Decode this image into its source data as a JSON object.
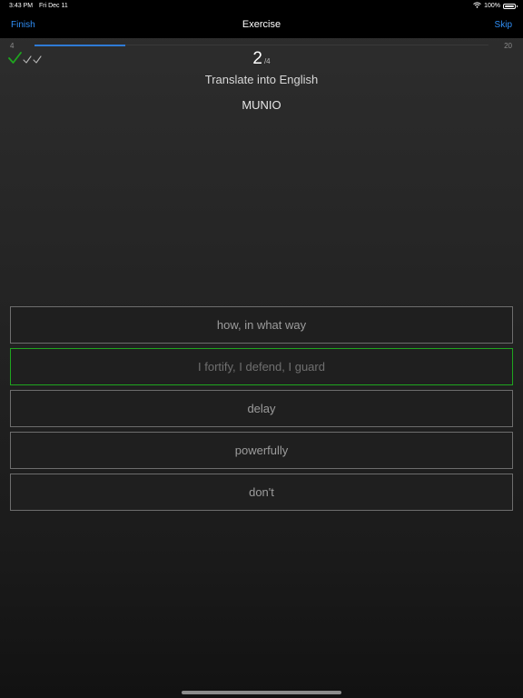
{
  "status_bar": {
    "time": "3:43 PM",
    "date": "Fri Dec 11",
    "battery": "100%",
    "icons": [
      "wifi-icon",
      "battery-icon"
    ]
  },
  "navbar": {
    "left_label": "Finish",
    "title": "Exercise",
    "right_label": "Skip",
    "accent_color": "#2f8ef5"
  },
  "progress": {
    "start_label": "4",
    "end_label": "20",
    "fraction": 0.2
  },
  "streak": {
    "icons": [
      "check-icon",
      "check-icon",
      "check-icon"
    ],
    "correct_color": "#1fa51f"
  },
  "question": {
    "number": "2",
    "total": "/4",
    "instruction": "Translate into English",
    "word": "MUNIO"
  },
  "options": [
    {
      "label": "how, in what way",
      "state": "normal"
    },
    {
      "label": "I fortify, I defend, I guard",
      "state": "correct"
    },
    {
      "label": "delay",
      "state": "normal"
    },
    {
      "label": "powerfully",
      "state": "normal"
    },
    {
      "label": "don't",
      "state": "normal"
    }
  ]
}
